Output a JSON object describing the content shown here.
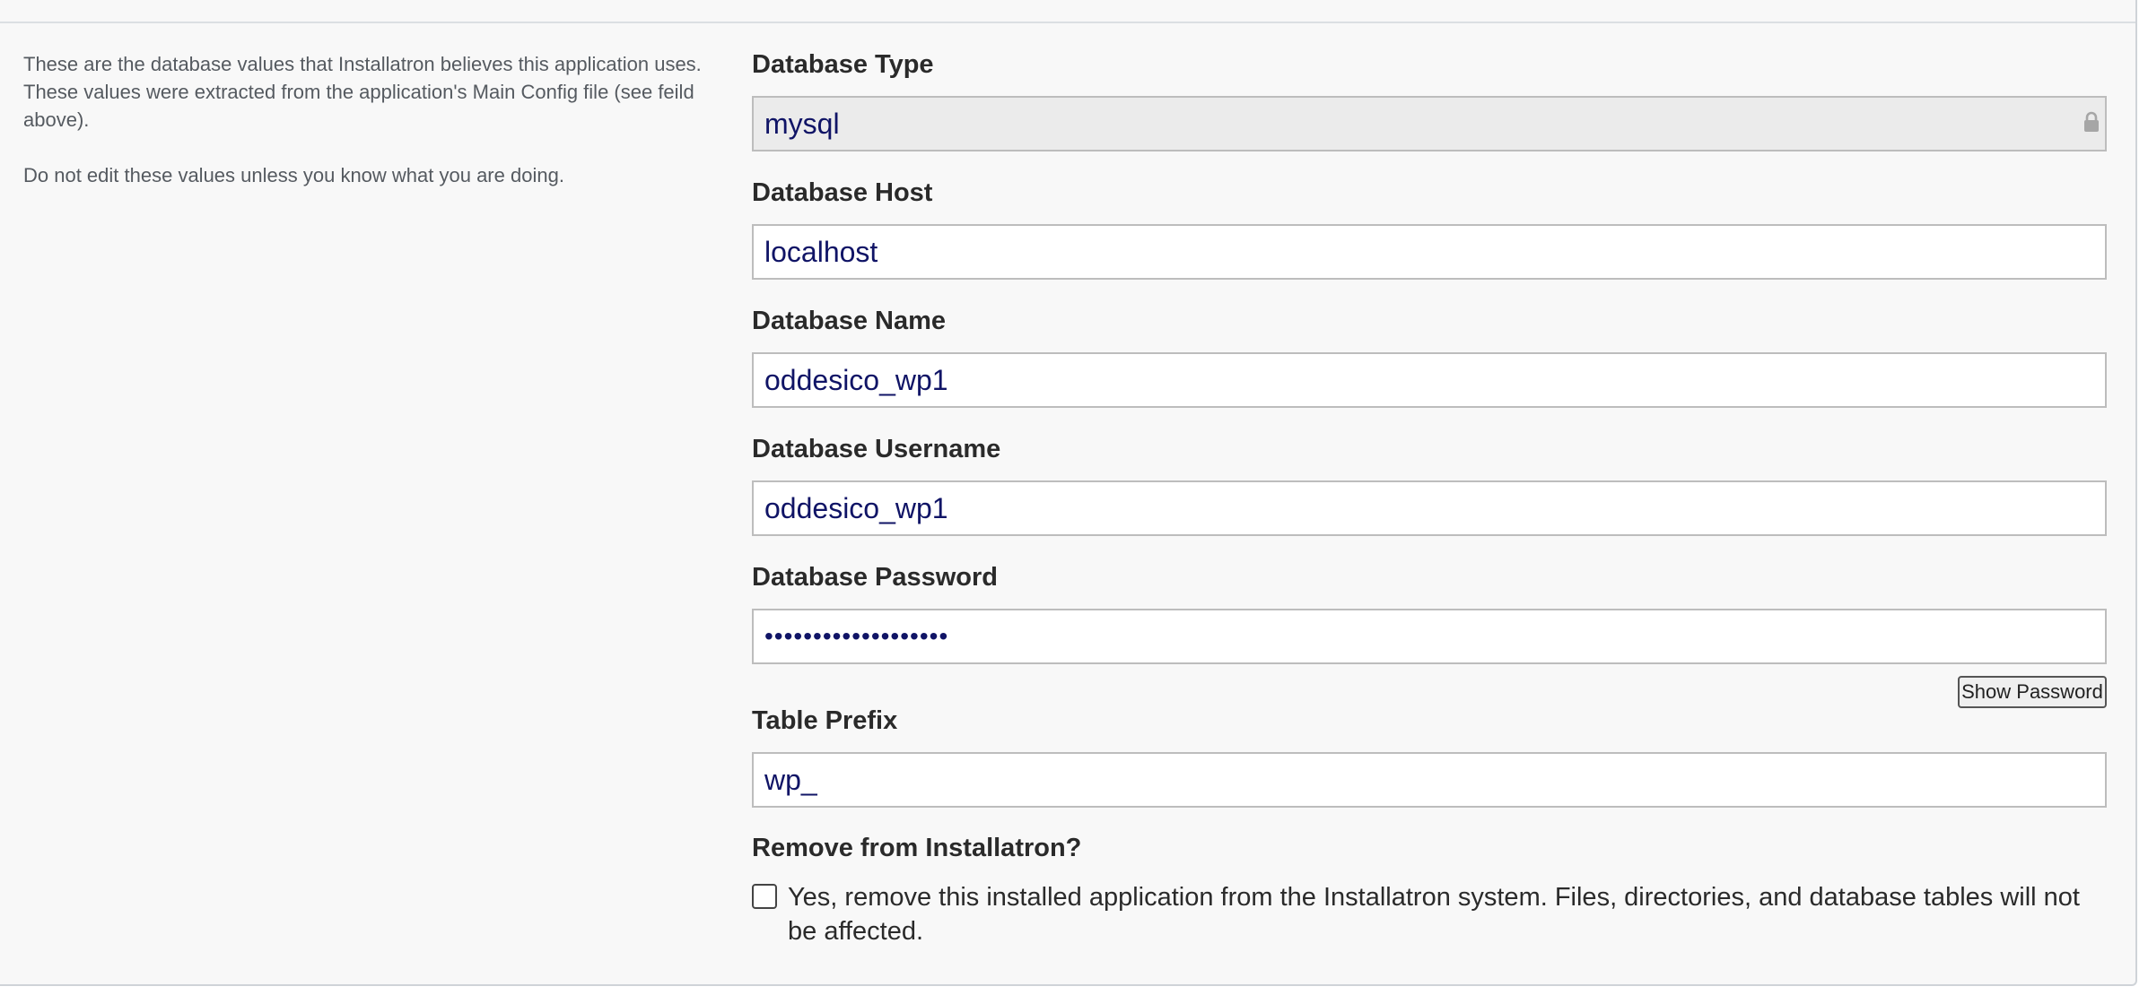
{
  "help": {
    "paragraph1": "These are the database values that Installatron believes this application uses. These values were extracted from the application's Main Config file (see feild above).",
    "paragraph2": "Do not edit these values unless you know what you are doing."
  },
  "fields": {
    "db_type": {
      "label": "Database Type",
      "value": "mysql"
    },
    "db_host": {
      "label": "Database Host",
      "value": "localhost"
    },
    "db_name": {
      "label": "Database Name",
      "value": "oddesico_wp1"
    },
    "db_user": {
      "label": "Database Username",
      "value": "oddesico_wp1"
    },
    "db_pass": {
      "label": "Database Password",
      "value": "•••••••••••••••••••"
    },
    "table_prefix": {
      "label": "Table Prefix",
      "value": "wp_"
    }
  },
  "show_password_label": "Show Password",
  "remove": {
    "label": "Remove from Installatron?",
    "checkbox_text": "Yes, remove this installed application from the Installatron system. Files, directories, and database tables will not be affected.",
    "checked": false
  },
  "icons": {
    "lock": "lock-icon"
  },
  "colors": {
    "input_text": "#101466",
    "locked_bg": "#ebebeb"
  }
}
